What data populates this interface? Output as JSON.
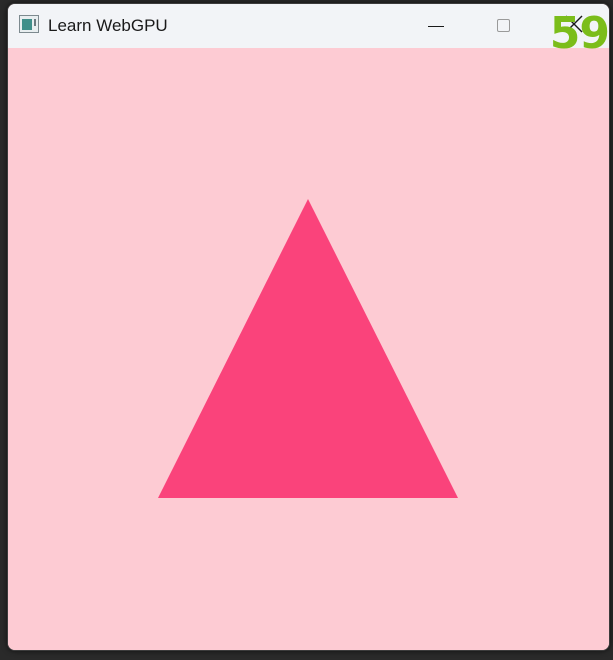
{
  "window": {
    "title": "Learn WebGPU",
    "icon": "app-window-icon",
    "controls": [
      "minimize-icon",
      "maximize-icon",
      "close-icon"
    ]
  },
  "canvas": {
    "clear_color": "#fdcbd3",
    "shape": "triangle",
    "shape_color": "#fa437b"
  },
  "overlay": {
    "fps_counter": "59",
    "fps_color": "#7bbd1a"
  }
}
